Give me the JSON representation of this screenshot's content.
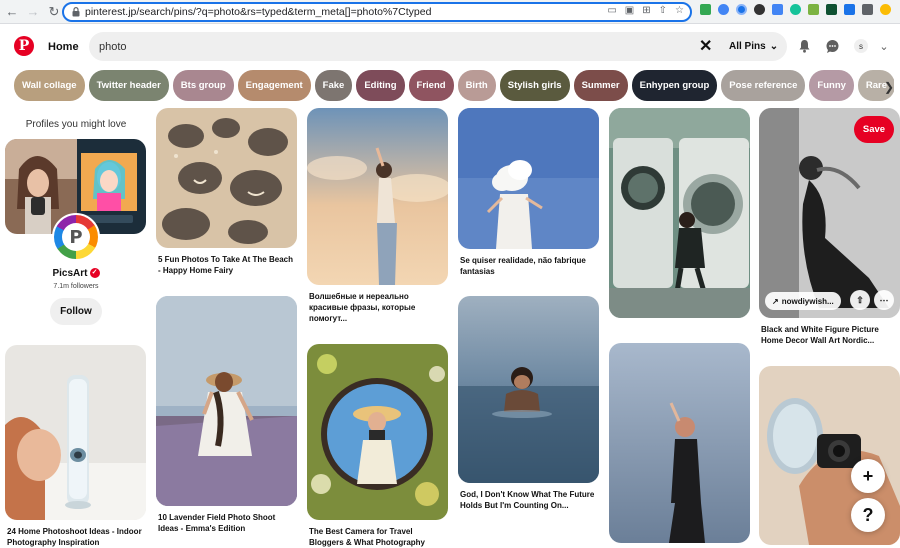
{
  "browser": {
    "url": "pinterest.jp/search/pins/?q=photo&rs=typed&term_meta[]=photo%7Ctyped"
  },
  "header": {
    "home_label": "Home",
    "search_value": "photo",
    "filter_label": "All Pins",
    "avatar_letter": "s"
  },
  "chips": [
    {
      "label": "Wall collage",
      "color": "#b89f7e"
    },
    {
      "label": "Twitter header",
      "color": "#7b8470"
    },
    {
      "label": "Bts group",
      "color": "#a98790"
    },
    {
      "label": "Engagement",
      "color": "#b58b6d"
    },
    {
      "label": "Fake",
      "color": "#7d7570"
    },
    {
      "label": "Editing",
      "color": "#7e4c5a"
    },
    {
      "label": "Friend",
      "color": "#8f5460"
    },
    {
      "label": "Birth",
      "color": "#b99b96"
    },
    {
      "label": "Stylish girls",
      "color": "#5a5a3e"
    },
    {
      "label": "Summer",
      "color": "#7c4d4a"
    },
    {
      "label": "Enhypen group",
      "color": "#1f2530"
    },
    {
      "label": "Pose reference",
      "color": "#a9a29d"
    },
    {
      "label": "Funny",
      "color": "#b59aa5"
    },
    {
      "label": "Rare",
      "color": "#b8b0a6"
    }
  ],
  "profiles": {
    "title": "Profiles you might love",
    "name": "PicsArt",
    "followers": "7.1m followers",
    "follow_label": "Follow",
    "logo_letter": "P"
  },
  "pins": {
    "c1_bottom": "24 Home Photoshoot Ideas - Indoor Photography Inspiration",
    "c2_top": "5 Fun Photos To Take At The Beach - Happy Home Fairy",
    "c2_bottom": "10 Lavender Field Photo Shoot Ideas - Emma's Edition",
    "c3_top": "Волшебные и нереально красивые фразы, которые помогут...",
    "c3_bottom": "The Best Camera for Travel Bloggers & What Photography",
    "c4_top": "Se quiser realidade, não fabrique fantasias",
    "c4_bottom": "God, I Don't Know What The Future Holds But I'm Counting On...",
    "c6_top": "Black and White Figure Picture Home Decor Wall Art Nordic...",
    "save_label": "Save",
    "link_label": "nowdiywish..."
  }
}
